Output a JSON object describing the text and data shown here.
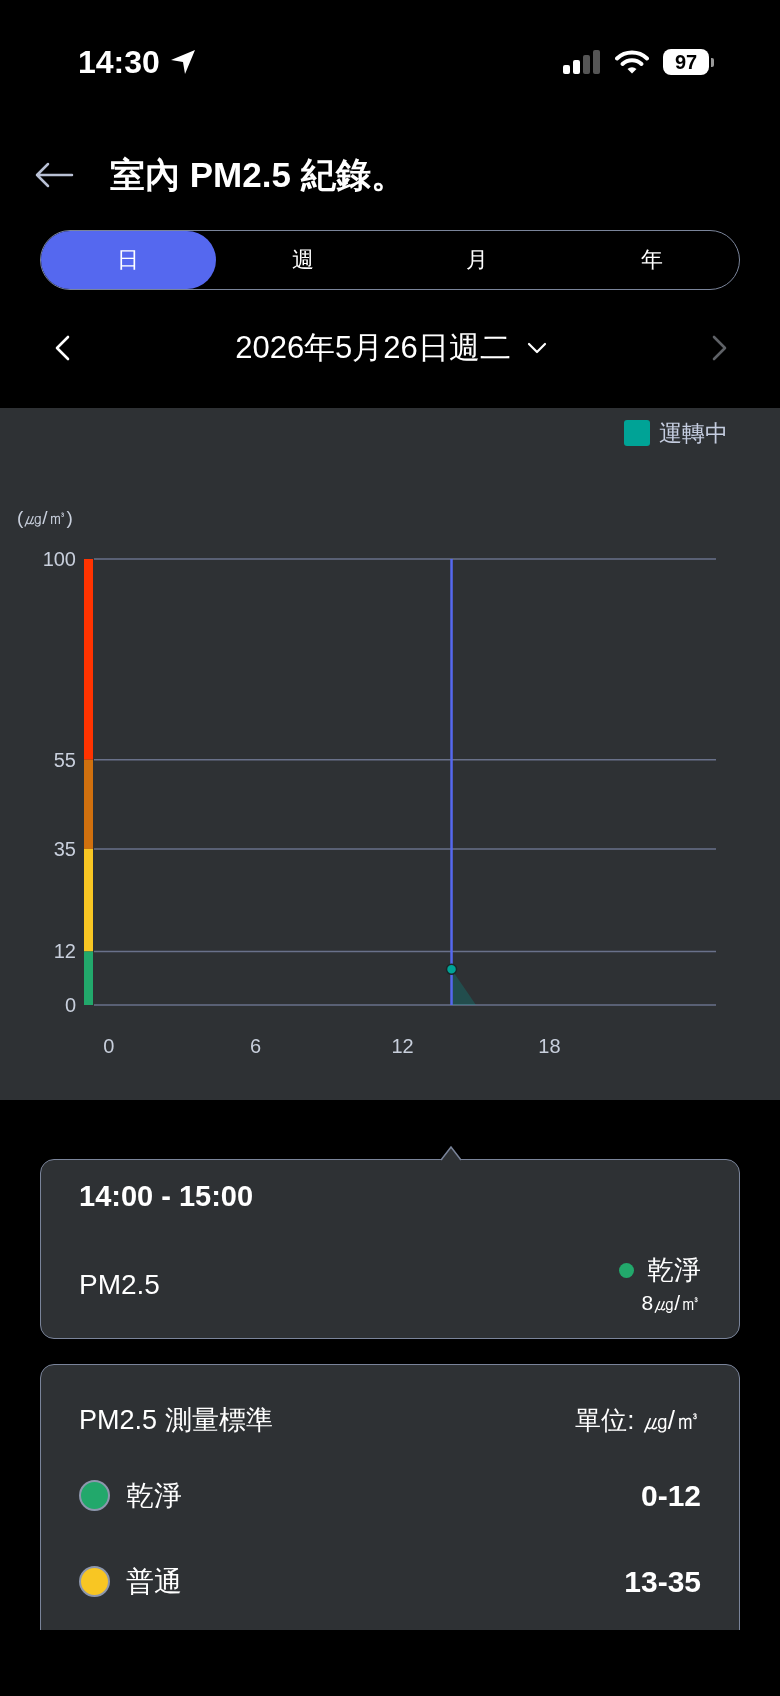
{
  "status_bar": {
    "time": "14:30",
    "battery": "97"
  },
  "header": {
    "title": "室內 PM2.5 紀錄。"
  },
  "period_tabs": [
    {
      "label": "日",
      "selected": true
    },
    {
      "label": "週",
      "selected": false
    },
    {
      "label": "月",
      "selected": false
    },
    {
      "label": "年",
      "selected": false
    }
  ],
  "date_nav": {
    "date": "2026年5月26日週二",
    "prev_disabled": false,
    "next_disabled": true
  },
  "chart": {
    "color_scale": [
      {
        "color": "#ff3300"
      },
      {
        "color": "#d0700e"
      },
      {
        "color": "#f8c623"
      },
      {
        "color": "#22a86b"
      }
    ],
    "chart_data": {
      "type": "area",
      "ylabel": "(㎍/㎥)",
      "x": [
        14,
        15
      ],
      "series": [
        {
          "name": "運轉中",
          "color": "#00a396",
          "values": [
            8,
            0
          ]
        }
      ],
      "xlim": [
        -0.6,
        24.8
      ],
      "ylim": [
        0,
        100
      ],
      "xticks": [
        0,
        6,
        12,
        18
      ],
      "yticks": [
        0,
        12,
        35,
        55,
        100
      ],
      "grid": true,
      "ref_lines": [
        {
          "axis": "x",
          "value": 14,
          "color": "#5568ef"
        }
      ]
    }
  },
  "tooltip": {
    "time_range": "14:00 - 15:00",
    "metric": "PM2.5",
    "status": {
      "label": "乾淨",
      "color": "#22a86b"
    },
    "value": "8㎍/㎥"
  },
  "standards": {
    "title": "PM2.5 測量標準",
    "unit": "單位: ㎍/㎥",
    "levels": [
      {
        "label": "乾淨",
        "range": "0-12",
        "color": "#22a86b"
      },
      {
        "label": "普通",
        "range": "13-35",
        "color": "#f8c623"
      }
    ]
  }
}
